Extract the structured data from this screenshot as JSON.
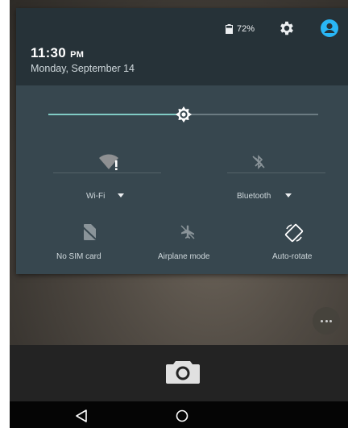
{
  "status_bar": {
    "battery_percent": "72%",
    "battery_level": 0.72,
    "icons": [
      "battery-icon",
      "settings-icon",
      "profile-icon"
    ]
  },
  "header": {
    "time": "11:30",
    "ampm": "PM",
    "date": "Monday, September 14"
  },
  "brightness": {
    "level": 0.5,
    "icon": "brightness-icon"
  },
  "tiles": {
    "wifi": {
      "label": "Wi-Fi",
      "icon": "wifi-icon"
    },
    "bluetooth": {
      "label": "Bluetooth",
      "icon": "bluetooth-off-icon"
    },
    "sim": {
      "label": "No SIM card",
      "icon": "no-sim-icon"
    },
    "airplane": {
      "label": "Airplane mode",
      "icon": "airplane-off-icon"
    },
    "rotate": {
      "label": "Auto-rotate",
      "icon": "auto-rotate-icon"
    }
  },
  "colors": {
    "accent": "#80cbc4",
    "header_bg": "#263238",
    "panel_bg": "#37474f",
    "profile": "#29b6f6"
  },
  "navigation": {
    "icons": [
      "back-icon",
      "home-icon"
    ]
  },
  "camera": {
    "icon": "camera-icon"
  }
}
